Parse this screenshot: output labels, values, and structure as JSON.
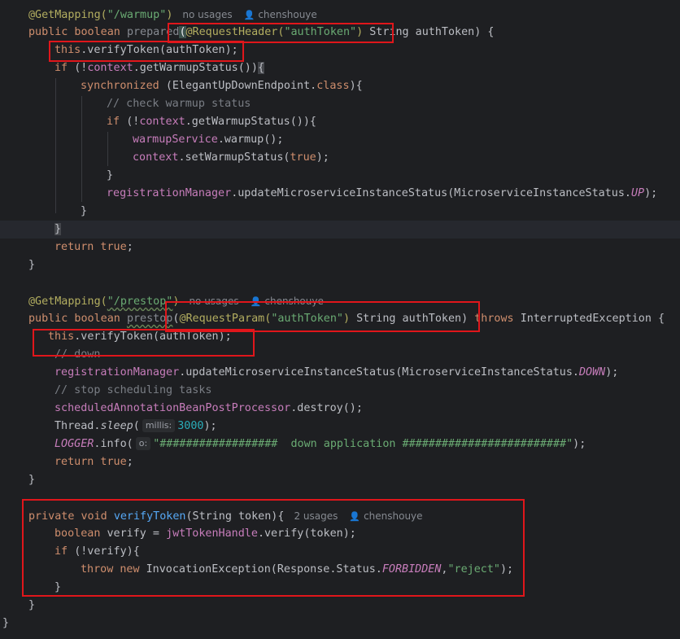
{
  "usage_meta": {
    "no_usages": "no usages",
    "two_usages": "2 usages",
    "author": "chenshouye",
    "author_icon": "user-icon"
  },
  "hints": {
    "millis": "millis:",
    "o": "o:"
  },
  "code": {
    "warmup_mapping_path": "\"/warmup\"",
    "prestop_mapping_path": "\"/prestop\"",
    "auth_token_str": "\"authToken\"",
    "comment_check_warmup": "// check warmup status",
    "comment_down": "// down",
    "comment_stop_tasks": "// stop scheduling tasks",
    "sleep_value": "3000",
    "logger_message": "\"##################  down application #########################\"",
    "reject_str": "\"reject\"",
    "status_up": "UP",
    "status_down": "DOWN",
    "status_forbidden": "FORBIDDEN"
  },
  "highlight_color": "#e0161b"
}
